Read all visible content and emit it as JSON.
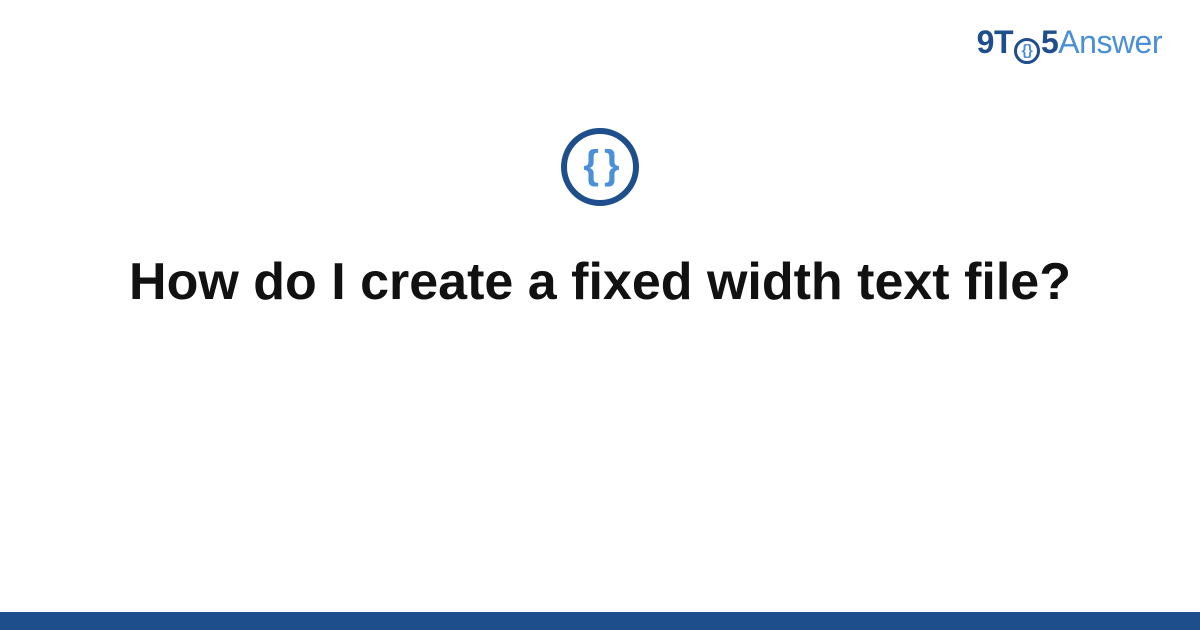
{
  "logo": {
    "part1": "9T",
    "clock_glyph": "{}",
    "part2": "5",
    "part3": "Answer"
  },
  "icon": {
    "glyph": "{ }",
    "name": "code-braces-icon"
  },
  "title": "How do I create a fixed width text file?",
  "colors": {
    "brand_dark": "#1e4e8c",
    "brand_light": "#4a8fd8"
  }
}
